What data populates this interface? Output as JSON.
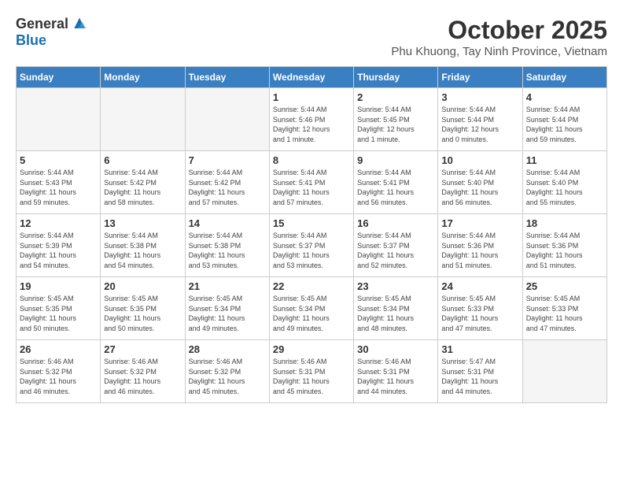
{
  "logo": {
    "general": "General",
    "blue": "Blue"
  },
  "title": "October 2025",
  "subtitle": "Phu Khuong, Tay Ninh Province, Vietnam",
  "headers": [
    "Sunday",
    "Monday",
    "Tuesday",
    "Wednesday",
    "Thursday",
    "Friday",
    "Saturday"
  ],
  "weeks": [
    [
      {
        "day": "",
        "info": ""
      },
      {
        "day": "",
        "info": ""
      },
      {
        "day": "",
        "info": ""
      },
      {
        "day": "1",
        "info": "Sunrise: 5:44 AM\nSunset: 5:46 PM\nDaylight: 12 hours\nand 1 minute."
      },
      {
        "day": "2",
        "info": "Sunrise: 5:44 AM\nSunset: 5:45 PM\nDaylight: 12 hours\nand 1 minute."
      },
      {
        "day": "3",
        "info": "Sunrise: 5:44 AM\nSunset: 5:44 PM\nDaylight: 12 hours\nand 0 minutes."
      },
      {
        "day": "4",
        "info": "Sunrise: 5:44 AM\nSunset: 5:44 PM\nDaylight: 11 hours\nand 59 minutes."
      }
    ],
    [
      {
        "day": "5",
        "info": "Sunrise: 5:44 AM\nSunset: 5:43 PM\nDaylight: 11 hours\nand 59 minutes."
      },
      {
        "day": "6",
        "info": "Sunrise: 5:44 AM\nSunset: 5:42 PM\nDaylight: 11 hours\nand 58 minutes."
      },
      {
        "day": "7",
        "info": "Sunrise: 5:44 AM\nSunset: 5:42 PM\nDaylight: 11 hours\nand 57 minutes."
      },
      {
        "day": "8",
        "info": "Sunrise: 5:44 AM\nSunset: 5:41 PM\nDaylight: 11 hours\nand 57 minutes."
      },
      {
        "day": "9",
        "info": "Sunrise: 5:44 AM\nSunset: 5:41 PM\nDaylight: 11 hours\nand 56 minutes."
      },
      {
        "day": "10",
        "info": "Sunrise: 5:44 AM\nSunset: 5:40 PM\nDaylight: 11 hours\nand 56 minutes."
      },
      {
        "day": "11",
        "info": "Sunrise: 5:44 AM\nSunset: 5:40 PM\nDaylight: 11 hours\nand 55 minutes."
      }
    ],
    [
      {
        "day": "12",
        "info": "Sunrise: 5:44 AM\nSunset: 5:39 PM\nDaylight: 11 hours\nand 54 minutes."
      },
      {
        "day": "13",
        "info": "Sunrise: 5:44 AM\nSunset: 5:38 PM\nDaylight: 11 hours\nand 54 minutes."
      },
      {
        "day": "14",
        "info": "Sunrise: 5:44 AM\nSunset: 5:38 PM\nDaylight: 11 hours\nand 53 minutes."
      },
      {
        "day": "15",
        "info": "Sunrise: 5:44 AM\nSunset: 5:37 PM\nDaylight: 11 hours\nand 53 minutes."
      },
      {
        "day": "16",
        "info": "Sunrise: 5:44 AM\nSunset: 5:37 PM\nDaylight: 11 hours\nand 52 minutes."
      },
      {
        "day": "17",
        "info": "Sunrise: 5:44 AM\nSunset: 5:36 PM\nDaylight: 11 hours\nand 51 minutes."
      },
      {
        "day": "18",
        "info": "Sunrise: 5:44 AM\nSunset: 5:36 PM\nDaylight: 11 hours\nand 51 minutes."
      }
    ],
    [
      {
        "day": "19",
        "info": "Sunrise: 5:45 AM\nSunset: 5:35 PM\nDaylight: 11 hours\nand 50 minutes."
      },
      {
        "day": "20",
        "info": "Sunrise: 5:45 AM\nSunset: 5:35 PM\nDaylight: 11 hours\nand 50 minutes."
      },
      {
        "day": "21",
        "info": "Sunrise: 5:45 AM\nSunset: 5:34 PM\nDaylight: 11 hours\nand 49 minutes."
      },
      {
        "day": "22",
        "info": "Sunrise: 5:45 AM\nSunset: 5:34 PM\nDaylight: 11 hours\nand 49 minutes."
      },
      {
        "day": "23",
        "info": "Sunrise: 5:45 AM\nSunset: 5:34 PM\nDaylight: 11 hours\nand 48 minutes."
      },
      {
        "day": "24",
        "info": "Sunrise: 5:45 AM\nSunset: 5:33 PM\nDaylight: 11 hours\nand 47 minutes."
      },
      {
        "day": "25",
        "info": "Sunrise: 5:45 AM\nSunset: 5:33 PM\nDaylight: 11 hours\nand 47 minutes."
      }
    ],
    [
      {
        "day": "26",
        "info": "Sunrise: 5:46 AM\nSunset: 5:32 PM\nDaylight: 11 hours\nand 46 minutes."
      },
      {
        "day": "27",
        "info": "Sunrise: 5:46 AM\nSunset: 5:32 PM\nDaylight: 11 hours\nand 46 minutes."
      },
      {
        "day": "28",
        "info": "Sunrise: 5:46 AM\nSunset: 5:32 PM\nDaylight: 11 hours\nand 45 minutes."
      },
      {
        "day": "29",
        "info": "Sunrise: 5:46 AM\nSunset: 5:31 PM\nDaylight: 11 hours\nand 45 minutes."
      },
      {
        "day": "30",
        "info": "Sunrise: 5:46 AM\nSunset: 5:31 PM\nDaylight: 11 hours\nand 44 minutes."
      },
      {
        "day": "31",
        "info": "Sunrise: 5:47 AM\nSunset: 5:31 PM\nDaylight: 11 hours\nand 44 minutes."
      },
      {
        "day": "",
        "info": ""
      }
    ]
  ]
}
